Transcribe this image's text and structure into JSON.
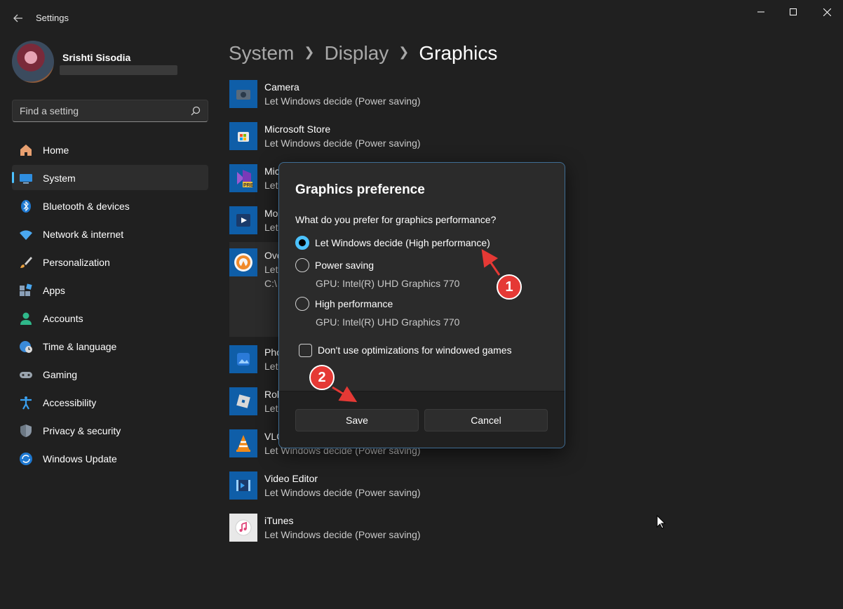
{
  "window": {
    "title": "Settings"
  },
  "profile": {
    "name": "Srishti Sisodia"
  },
  "search": {
    "placeholder": "Find a setting"
  },
  "sidebar": {
    "items": [
      {
        "label": "Home",
        "icon": "home-icon"
      },
      {
        "label": "System",
        "icon": "system-icon",
        "active": true
      },
      {
        "label": "Bluetooth & devices",
        "icon": "bluetooth-icon"
      },
      {
        "label": "Network & internet",
        "icon": "wifi-icon"
      },
      {
        "label": "Personalization",
        "icon": "brush-icon"
      },
      {
        "label": "Apps",
        "icon": "apps-icon"
      },
      {
        "label": "Accounts",
        "icon": "person-icon"
      },
      {
        "label": "Time & language",
        "icon": "globe-clock-icon"
      },
      {
        "label": "Gaming",
        "icon": "gamepad-icon"
      },
      {
        "label": "Accessibility",
        "icon": "accessibility-icon"
      },
      {
        "label": "Privacy & security",
        "icon": "shield-icon"
      },
      {
        "label": "Windows Update",
        "icon": "update-icon"
      }
    ]
  },
  "breadcrumb": [
    "System",
    "Display",
    "Graphics"
  ],
  "apps": [
    {
      "name": "Camera",
      "pref": "Let Windows decide (Power saving)"
    },
    {
      "name": "Microsoft Store",
      "pref": "Let Windows decide (Power saving)"
    },
    {
      "name": "Mic",
      "pref": "Let"
    },
    {
      "name": "Mo",
      "pref": "Let"
    },
    {
      "name": "Ove",
      "pref": "Let",
      "extra": "C:\\"
    },
    {
      "name": "Pho",
      "pref": "Let"
    },
    {
      "name": "Rob",
      "pref": "Let"
    },
    {
      "name": "VLC",
      "pref": "Let Windows decide (Power saving)"
    },
    {
      "name": "Video Editor",
      "pref": "Let Windows decide (Power saving)"
    },
    {
      "name": "iTunes",
      "pref": "Let Windows decide (Power saving)"
    }
  ],
  "dialog": {
    "title": "Graphics preference",
    "question": "What do you prefer for graphics performance?",
    "options": [
      {
        "label": "Let Windows decide (High performance)",
        "sub": "",
        "checked": true
      },
      {
        "label": "Power saving",
        "sub": "GPU: Intel(R) UHD Graphics 770",
        "checked": false
      },
      {
        "label": "High performance",
        "sub": "GPU: Intel(R) UHD Graphics 770",
        "checked": false
      }
    ],
    "checkbox_label": "Don't use optimizations for windowed games",
    "save_label": "Save",
    "cancel_label": "Cancel"
  },
  "annotations": [
    "1",
    "2"
  ],
  "colors": {
    "accent": "#4cc2ff",
    "annotation": "#e53935",
    "background": "#202020"
  }
}
